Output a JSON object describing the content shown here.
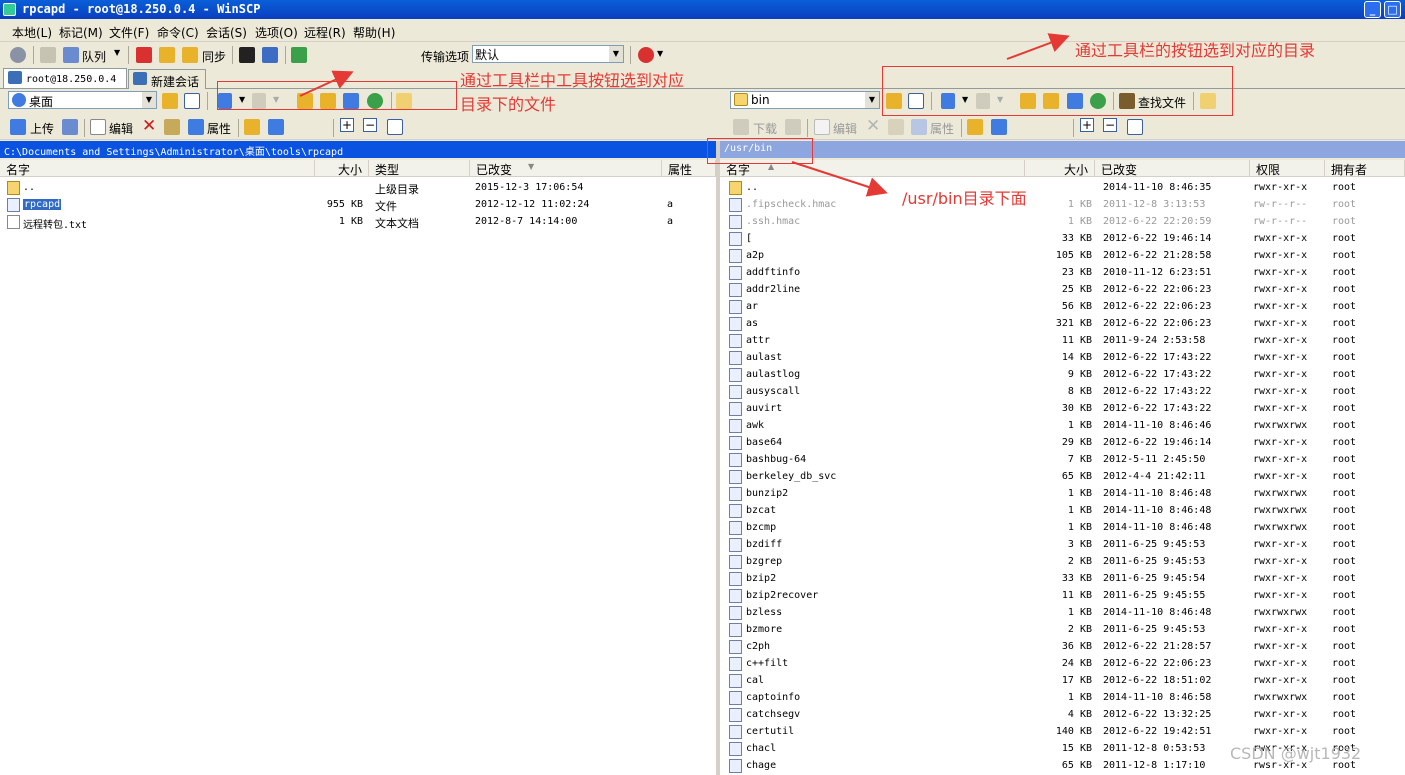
{
  "window": {
    "title": "rpcapd - root@18.250.0.4 - WinSCP"
  },
  "menu": [
    "本地(L)",
    "标记(M)",
    "文件(F)",
    "命令(C)",
    "会话(S)",
    "选项(O)",
    "远程(R)",
    "帮助(H)"
  ],
  "toolbar_main": {
    "queue_label": "队列",
    "sync_label": "同步",
    "transfer_options_label": "传输选项",
    "transfer_options_value": "默认"
  },
  "sessions": {
    "active_tab": "root@18.250.0.4",
    "new_session": "新建会话"
  },
  "local": {
    "location": "桌面",
    "upload_label": "上传",
    "edit_label": "编辑",
    "properties_label": "属性",
    "path": "C:\\Documents and Settings\\Administrator\\桌面\\tools\\rpcapd",
    "columns": [
      "名字",
      "大小",
      "类型",
      "已改变",
      "属性"
    ],
    "files": [
      {
        "name": "..",
        "size": "",
        "type": "上级目录",
        "changed": "2015-12-3   17:06:54",
        "attr": "",
        "icon": "folder-up-icon"
      },
      {
        "name": "rpcapd",
        "size": "955 KB",
        "type": "文件",
        "changed": "2012-12-12   11:02:24",
        "attr": "a",
        "icon": "file-icon"
      },
      {
        "name": "远程转包.txt",
        "size": "1 KB",
        "type": "文本文档",
        "changed": "2012-8-7   14:14:00",
        "attr": "a",
        "icon": "text-file-icon"
      }
    ]
  },
  "remote": {
    "location": "bin",
    "download_label": "下载",
    "edit_label": "编辑",
    "properties_label": "属性",
    "find_files_label": "查找文件",
    "path": "/usr/bin",
    "columns": [
      "名字",
      "大小",
      "已改变",
      "权限",
      "拥有者"
    ],
    "files": [
      {
        "name": "..",
        "size": "",
        "changed": "2014-11-10 8:46:35",
        "rights": "rwxr-xr-x",
        "owner": "root"
      },
      {
        "name": ".fipscheck.hmac",
        "size": "1 KB",
        "changed": "2011-12-8 3:13:53",
        "rights": "rw-r--r--",
        "owner": "root"
      },
      {
        "name": ".ssh.hmac",
        "size": "1 KB",
        "changed": "2012-6-22 22:20:59",
        "rights": "rw-r--r--",
        "owner": "root"
      },
      {
        "name": "[",
        "size": "33 KB",
        "changed": "2012-6-22 19:46:14",
        "rights": "rwxr-xr-x",
        "owner": "root"
      },
      {
        "name": "a2p",
        "size": "105 KB",
        "changed": "2012-6-22 21:28:58",
        "rights": "rwxr-xr-x",
        "owner": "root"
      },
      {
        "name": "addftinfo",
        "size": "23 KB",
        "changed": "2010-11-12 6:23:51",
        "rights": "rwxr-xr-x",
        "owner": "root"
      },
      {
        "name": "addr2line",
        "size": "25 KB",
        "changed": "2012-6-22 22:06:23",
        "rights": "rwxr-xr-x",
        "owner": "root"
      },
      {
        "name": "ar",
        "size": "56 KB",
        "changed": "2012-6-22 22:06:23",
        "rights": "rwxr-xr-x",
        "owner": "root"
      },
      {
        "name": "as",
        "size": "321 KB",
        "changed": "2012-6-22 22:06:23",
        "rights": "rwxr-xr-x",
        "owner": "root"
      },
      {
        "name": "attr",
        "size": "11 KB",
        "changed": "2011-9-24 2:53:58",
        "rights": "rwxr-xr-x",
        "owner": "root"
      },
      {
        "name": "aulast",
        "size": "14 KB",
        "changed": "2012-6-22 17:43:22",
        "rights": "rwxr-xr-x",
        "owner": "root"
      },
      {
        "name": "aulastlog",
        "size": "9 KB",
        "changed": "2012-6-22 17:43:22",
        "rights": "rwxr-xr-x",
        "owner": "root"
      },
      {
        "name": "ausyscall",
        "size": "8 KB",
        "changed": "2012-6-22 17:43:22",
        "rights": "rwxr-xr-x",
        "owner": "root"
      },
      {
        "name": "auvirt",
        "size": "30 KB",
        "changed": "2012-6-22 17:43:22",
        "rights": "rwxr-xr-x",
        "owner": "root"
      },
      {
        "name": "awk",
        "size": "1 KB",
        "changed": "2014-11-10 8:46:46",
        "rights": "rwxrwxrwx",
        "owner": "root"
      },
      {
        "name": "base64",
        "size": "29 KB",
        "changed": "2012-6-22 19:46:14",
        "rights": "rwxr-xr-x",
        "owner": "root"
      },
      {
        "name": "bashbug-64",
        "size": "7 KB",
        "changed": "2012-5-11 2:45:50",
        "rights": "rwxr-xr-x",
        "owner": "root"
      },
      {
        "name": "berkeley_db_svc",
        "size": "65 KB",
        "changed": "2012-4-4 21:42:11",
        "rights": "rwxr-xr-x",
        "owner": "root"
      },
      {
        "name": "bunzip2",
        "size": "1 KB",
        "changed": "2014-11-10 8:46:48",
        "rights": "rwxrwxrwx",
        "owner": "root"
      },
      {
        "name": "bzcat",
        "size": "1 KB",
        "changed": "2014-11-10 8:46:48",
        "rights": "rwxrwxrwx",
        "owner": "root"
      },
      {
        "name": "bzcmp",
        "size": "1 KB",
        "changed": "2014-11-10 8:46:48",
        "rights": "rwxrwxrwx",
        "owner": "root"
      },
      {
        "name": "bzdiff",
        "size": "3 KB",
        "changed": "2011-6-25 9:45:53",
        "rights": "rwxr-xr-x",
        "owner": "root"
      },
      {
        "name": "bzgrep",
        "size": "2 KB",
        "changed": "2011-6-25 9:45:53",
        "rights": "rwxr-xr-x",
        "owner": "root"
      },
      {
        "name": "bzip2",
        "size": "33 KB",
        "changed": "2011-6-25 9:45:54",
        "rights": "rwxr-xr-x",
        "owner": "root"
      },
      {
        "name": "bzip2recover",
        "size": "11 KB",
        "changed": "2011-6-25 9:45:55",
        "rights": "rwxr-xr-x",
        "owner": "root"
      },
      {
        "name": "bzless",
        "size": "1 KB",
        "changed": "2014-11-10 8:46:48",
        "rights": "rwxrwxrwx",
        "owner": "root"
      },
      {
        "name": "bzmore",
        "size": "2 KB",
        "changed": "2011-6-25 9:45:53",
        "rights": "rwxr-xr-x",
        "owner": "root"
      },
      {
        "name": "c2ph",
        "size": "36 KB",
        "changed": "2012-6-22 21:28:57",
        "rights": "rwxr-xr-x",
        "owner": "root"
      },
      {
        "name": "c++filt",
        "size": "24 KB",
        "changed": "2012-6-22 22:06:23",
        "rights": "rwxr-xr-x",
        "owner": "root"
      },
      {
        "name": "cal",
        "size": "17 KB",
        "changed": "2012-6-22 18:51:02",
        "rights": "rwxr-xr-x",
        "owner": "root"
      },
      {
        "name": "captoinfo",
        "size": "1 KB",
        "changed": "2014-11-10 8:46:58",
        "rights": "rwxrwxrwx",
        "owner": "root"
      },
      {
        "name": "catchsegv",
        "size": "4 KB",
        "changed": "2012-6-22 13:32:25",
        "rights": "rwxr-xr-x",
        "owner": "root"
      },
      {
        "name": "certutil",
        "size": "140 KB",
        "changed": "2012-6-22 19:42:51",
        "rights": "rwxr-xr-x",
        "owner": "root"
      },
      {
        "name": "chacl",
        "size": "15 KB",
        "changed": "2011-12-8 0:53:53",
        "rights": "rwxr-xr-x",
        "owner": "root"
      },
      {
        "name": "chage",
        "size": "65 KB",
        "changed": "2011-12-8 1:17:10",
        "rights": "rwsr-xr-x",
        "owner": "root"
      }
    ]
  },
  "annotations": {
    "left_toolbar_note_line1": "通过工具栏中工具按钮选到对应",
    "left_toolbar_note_line2": "目录下的文件",
    "right_toolbar_note": "通过工具栏的按钮选到对应的目录",
    "remote_path_note": "/usr/bin目录下面",
    "color": "#e53935"
  },
  "watermark": "CSDN @wjt1932"
}
